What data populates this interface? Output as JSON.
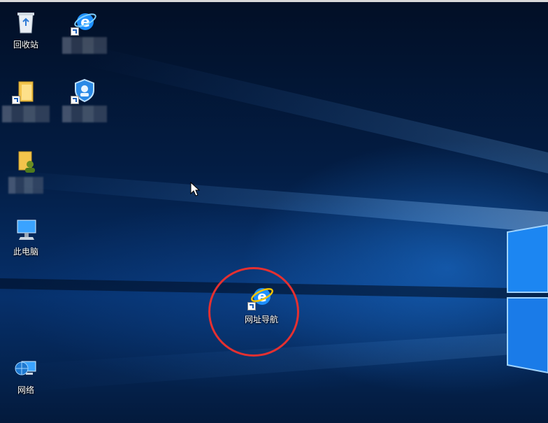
{
  "desktop_icons": {
    "recycle_bin": "回收站",
    "this_pc": "此电脑",
    "network": "网络",
    "web_nav": "网址导航"
  },
  "colors": {
    "highlight": "#e53030",
    "ie_blue": "#1e90ff",
    "ie_ring": "#f5c400"
  },
  "icons": [
    "recycle-bin-icon",
    "ie-icon",
    "folder-icon",
    "security-shield-icon",
    "user-folder-icon",
    "computer-icon",
    "network-icon",
    "cursor-icon"
  ]
}
